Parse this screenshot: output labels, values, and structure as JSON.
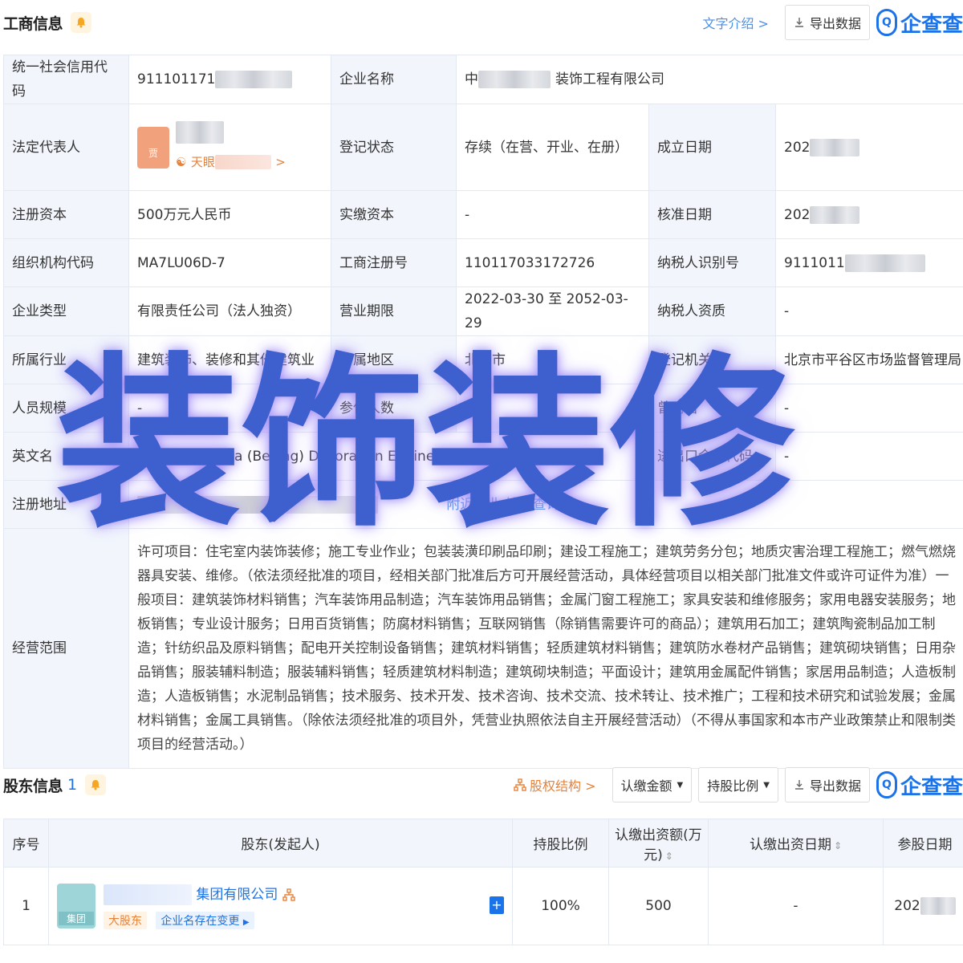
{
  "business_section": {
    "title": "工商信息",
    "text_intro_link": "文字介绍 >",
    "export_button": "导出数据",
    "logo_text": "企查查"
  },
  "info": {
    "credit_code_label": "统一社会信用代码",
    "credit_code_value": "911101171",
    "company_name_label": "企业名称",
    "company_name_prefix": "中",
    "company_name_suffix": "装饰工程有限公司",
    "legal_rep_label": "法定代表人",
    "legal_rep_avatar_char": "贾",
    "legal_rep_tianyan": "天眼",
    "reg_status_label": "登记状态",
    "reg_status_value": "存续（在营、开业、在册）",
    "established_label": "成立日期",
    "established_value": "202",
    "reg_capital_label": "注册资本",
    "reg_capital_value": "500万元人民币",
    "paid_capital_label": "实缴资本",
    "paid_capital_value": "-",
    "approval_date_label": "核准日期",
    "approval_date_value": "202",
    "org_code_label": "组织机构代码",
    "org_code_value": "MA7LU06D-7",
    "reg_number_label": "工商注册号",
    "reg_number_value": "110117033172726",
    "taxpayer_id_label": "纳税人识别号",
    "taxpayer_id_value": "9111011",
    "company_type_label": "企业类型",
    "company_type_value": "有限责任公司（法人独资）",
    "business_term_label": "营业期限",
    "business_term_value": "2022-03-30 至 2052-03-29",
    "taxpayer_qual_label": "纳税人资质",
    "taxpayer_qual_value": "-",
    "industry_label": "所属行业",
    "industry_value": "建筑装饰、装修和其他建筑业",
    "region_label": "所属地区",
    "region_value": "北京市",
    "reg_authority_label": "登记机关",
    "reg_authority_value": "北京市平谷区市场监督管理局",
    "staff_size_label": "人员规模",
    "staff_size_value": "-",
    "insured_label": "参保人数",
    "insured_value": "-",
    "former_name_label": "曾用名",
    "former_name_value": "-",
    "english_name_label": "英文名",
    "english_name_value": "Zhongjianuaxia (Beijing) Decoration Engineering Co., Ltd.（自动翻译）",
    "import_export_label": "进出口企业代码",
    "import_export_value": "-",
    "address_label": "注册地址",
    "address_link": "附近企业  地址查询",
    "scope_label": "经营范围",
    "scope_value": "许可项目：住宅室内装饰装修；施工专业作业；包装装潢印刷品印刷；建设工程施工；建筑劳务分包；地质灾害治理工程施工；燃气燃烧器具安装、维修。（依法须经批准的项目，经相关部门批准后方可开展经营活动，具体经营项目以相关部门批准文件或许可证件为准）一般项目：建筑装饰材料销售；汽车装饰用品制造；汽车装饰用品销售；金属门窗工程施工；家具安装和维修服务；家用电器安装服务；地板销售；专业设计服务；日用百货销售；防腐材料销售；互联网销售（除销售需要许可的商品）；建筑用石加工；建筑陶瓷制品加工制造；针纺织品及原料销售；配电开关控制设备销售；建筑材料销售；轻质建筑材料销售；建筑防水卷材产品销售；建筑砌块销售；日用杂品销售；服装辅料制造；服装辅料销售；轻质建筑材料制造；建筑砌块制造；平面设计；建筑用金属配件销售；家居用品制造；人造板制造；人造板销售；水泥制品销售；技术服务、技术开发、技术咨询、技术交流、技术转让、技术推广；工程和技术研究和试验发展；金属材料销售；金属工具销售。（除依法须经批准的项目外，凭营业执照依法自主开展经营活动）（不得从事国家和本市产业政策禁止和限制类项目的经营活动。）"
  },
  "watermark": "装饰装修",
  "shareholder_section": {
    "title": "股东信息",
    "count": "1",
    "equity_structure_link": "股权结构 >",
    "subscribed_amount_button": "认缴金额",
    "holding_ratio_button": "持股比例",
    "export_button": "导出数据",
    "logo_text": "企查查"
  },
  "holders_table": {
    "headers": {
      "index": "序号",
      "holder": "股东(发起人)",
      "ratio": "持股比例",
      "amount": "认缴出资额(万元)",
      "date": "认缴出资日期",
      "join_date": "参股日期"
    },
    "rows": [
      {
        "index": "1",
        "name_suffix": "集团有限公司",
        "logo_label": "集团",
        "tag_big": "大股东",
        "tag_change": "企业名存在变更",
        "ratio": "100%",
        "amount": "500",
        "date": "-",
        "join_date": "202"
      }
    ]
  }
}
